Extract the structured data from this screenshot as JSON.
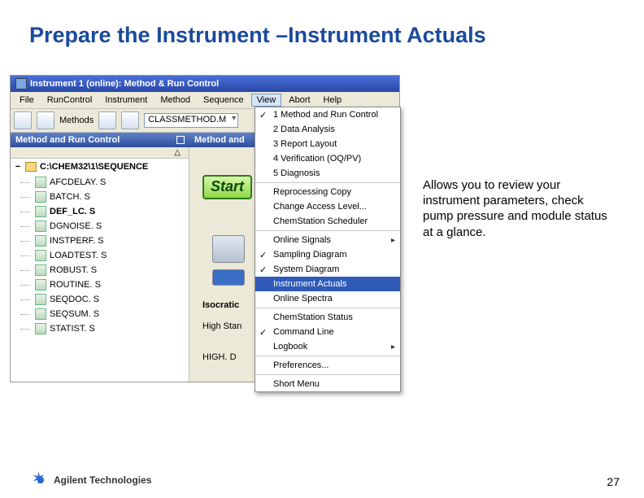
{
  "slide": {
    "title": "Prepare the Instrument –Instrument Actuals",
    "page_number": "27",
    "logo": "Agilent Technologies"
  },
  "explain": "Allows you to review your instrument parameters, check pump pressure and module status at a glance.",
  "window": {
    "title": "Instrument 1 (online): Method & Run Control"
  },
  "menubar": [
    "File",
    "RunControl",
    "Instrument",
    "Method",
    "Sequence",
    "View",
    "Abort",
    "Help"
  ],
  "toolbar": {
    "methods_label": "Methods",
    "method_combo": "CLASSMETHOD.M"
  },
  "subbar": {
    "left": "Method and Run Control",
    "mid": "Method and"
  },
  "tree": {
    "delta": "△",
    "root": "C:\\CHEM32\\1\\SEQUENCE",
    "files": [
      "AFCDELAY. S",
      "BATCH. S",
      "DEF_LC. S",
      "DGNOISE. S",
      "INSTPERF. S",
      "LOADTEST. S",
      "ROBUST. S",
      "ROUTINE. S",
      "SEQDOC. S",
      "SEQSUM. S",
      "STATIST. S"
    ]
  },
  "canvas": {
    "start": "Start",
    "isocratic": "Isocratic",
    "high_stan": "High Stan",
    "high_d": "HIGH. D"
  },
  "view_menu": {
    "items": [
      {
        "label": "1 Method and Run Control",
        "checked": true
      },
      {
        "label": "2 Data Analysis"
      },
      {
        "label": "3 Report Layout"
      },
      {
        "label": "4 Verification (OQ/PV)"
      },
      {
        "label": "5 Diagnosis"
      },
      {
        "label": "Reprocessing Copy",
        "sep": true
      },
      {
        "label": "Change Access Level..."
      },
      {
        "label": "ChemStation Scheduler"
      },
      {
        "label": "Online Signals",
        "sep": true,
        "sub": true
      },
      {
        "label": "Sampling Diagram",
        "checked": true
      },
      {
        "label": "System Diagram",
        "checked": true
      },
      {
        "label": "Instrument Actuals",
        "selected": true
      },
      {
        "label": "Online Spectra"
      },
      {
        "label": "ChemStation Status",
        "sep": true
      },
      {
        "label": "Command Line",
        "checked": true
      },
      {
        "label": "Logbook",
        "sub": true
      },
      {
        "label": "Preferences...",
        "sep": true
      },
      {
        "label": "Short Menu",
        "sep": true
      }
    ]
  }
}
